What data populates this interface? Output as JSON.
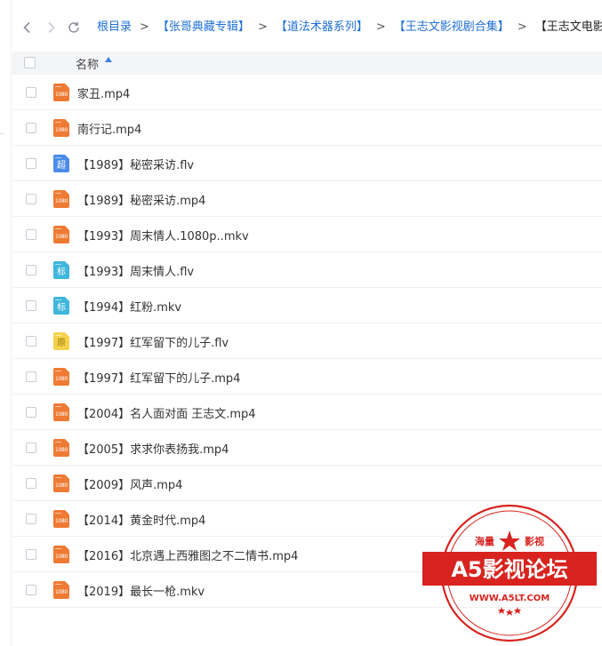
{
  "breadcrumb": {
    "items": [
      {
        "label": "根目录"
      },
      {
        "label": "【张哥典藏专辑】"
      },
      {
        "label": "【道法术器系列】"
      },
      {
        "label": "【王志文影视剧合集】"
      }
    ],
    "current": "【王志文电影】",
    "separator": ">"
  },
  "header": {
    "name_label": "名称",
    "sort": "ascending"
  },
  "files": [
    {
      "name": "家丑.mp4",
      "icon": "video-file-icon",
      "icon_text": "1080"
    },
    {
      "name": "南行记.mp4",
      "icon": "video-file-icon",
      "icon_text": "1080"
    },
    {
      "name": "【1989】秘密采访.flv",
      "icon": "super-hd-icon",
      "icon_text": "超"
    },
    {
      "name": "【1989】秘密采访.mp4",
      "icon": "video-file-icon",
      "icon_text": "1080"
    },
    {
      "name": "【1993】周末情人.1080p..mkv",
      "icon": "video-file-icon",
      "icon_text": "1080"
    },
    {
      "name": "【1993】周末情人.flv",
      "icon": "standard-def-icon",
      "icon_text": "标"
    },
    {
      "name": "【1994】红粉.mkv",
      "icon": "standard-def-icon",
      "icon_text": "标"
    },
    {
      "name": "【1997】红军留下的儿子.flv",
      "icon": "original-quality-icon",
      "icon_text": "原"
    },
    {
      "name": "【1997】红军留下的儿子.mp4",
      "icon": "video-file-icon",
      "icon_text": "1080"
    },
    {
      "name": "【2004】名人面对面 王志文.mp4",
      "icon": "video-file-icon",
      "icon_text": "1080"
    },
    {
      "name": "【2005】求求你表扬我.mp4",
      "icon": "video-file-icon",
      "icon_text": "1080"
    },
    {
      "name": "【2009】风声.mp4",
      "icon": "video-file-icon",
      "icon_text": "1080"
    },
    {
      "name": "【2014】黄金时代.mp4",
      "icon": "video-file-icon",
      "icon_text": "1080"
    },
    {
      "name": "【2016】北京遇上西雅图之不二情书.mp4",
      "icon": "video-file-icon",
      "icon_text": "1080"
    },
    {
      "name": "【2019】最长一枪.mkv",
      "icon": "video-file-icon",
      "icon_text": "1080"
    }
  ],
  "watermark": {
    "top_text_left": "海量",
    "top_text_right": "影视",
    "title": "A5影视论坛",
    "url": "WWW.A5LT.COM"
  },
  "colors": {
    "link": "#1f6fd6",
    "video_icon": "#ee7a33",
    "stamp_red": "#d8231e"
  }
}
